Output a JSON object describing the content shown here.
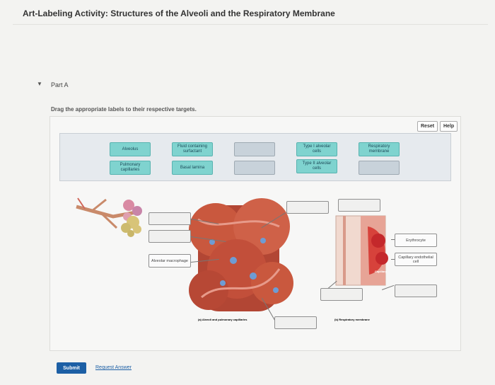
{
  "page": {
    "title": "Art-Labeling Activity: Structures of the Alveoli and the Respiratory Membrane",
    "part_label": "Part A",
    "instruction": "Drag the appropriate labels to their respective targets."
  },
  "toolbar": {
    "reset_label": "Reset",
    "help_label": "Help"
  },
  "label_bank": [
    "Alveolus",
    "Fluid containing surfactant",
    "Type I alveolar cells",
    "Respiratory membrane",
    "Pulmonary capillaries",
    "Basal lamina",
    "Type II alveolar cells"
  ],
  "placed_labels": {
    "macrophage": "Alveolar macrophage",
    "erythrocyte": "Erythrocyte",
    "endothelial": "Capillary endothelial cell"
  },
  "figure": {
    "caption_a": "(a) Alveoli and pulmonary capillaries",
    "caption_b": "(b) Respiratory membrane",
    "capillary_text": "Capillary"
  },
  "footer": {
    "submit_label": "Submit",
    "request_answer_label": "Request Answer"
  }
}
